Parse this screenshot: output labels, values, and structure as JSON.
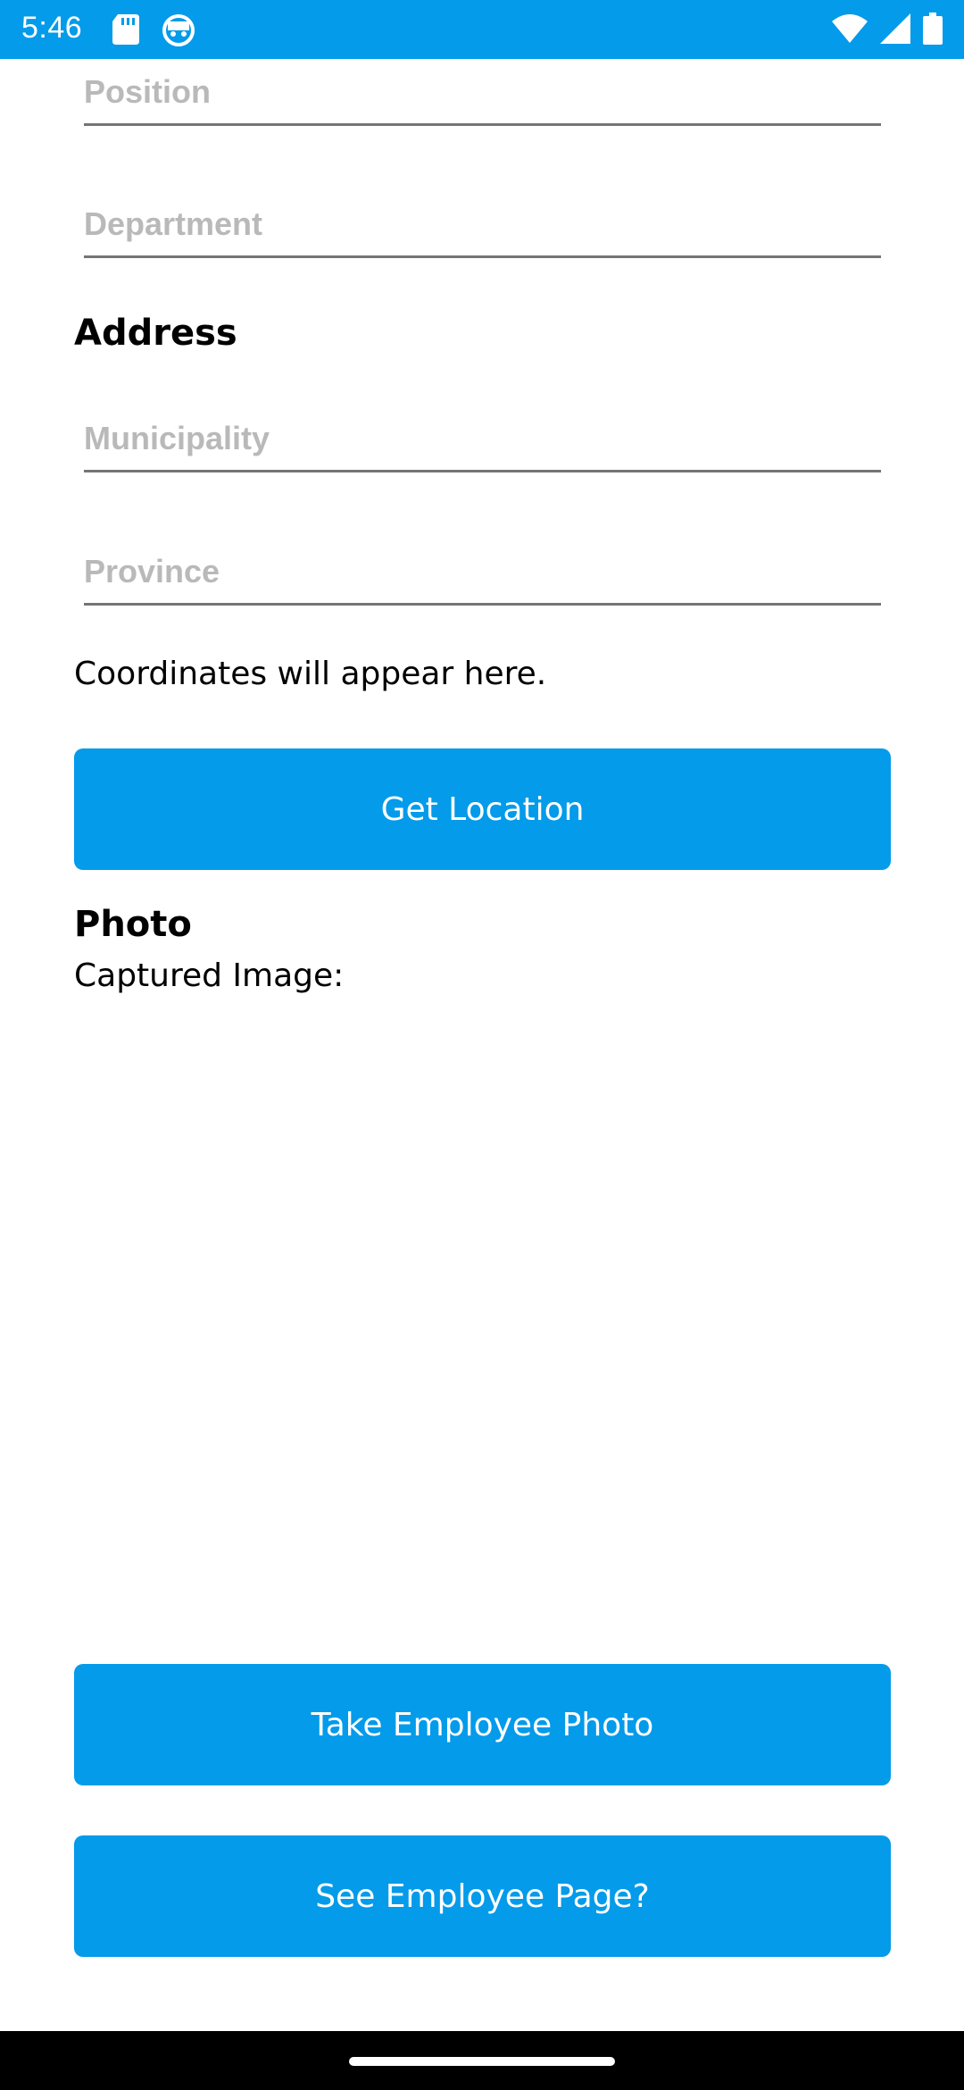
{
  "status_bar": {
    "time": "5:46",
    "left_icons": [
      "sd-card-icon",
      "android-face-icon"
    ],
    "right_icons": [
      "wifi-icon",
      "signal-icon",
      "battery-icon"
    ],
    "color": "#039BEA"
  },
  "form": {
    "position_placeholder": "Position",
    "department_placeholder": "Department",
    "address_heading": "Address",
    "municipality_placeholder": "Municipality",
    "province_placeholder": "Province",
    "coordinates_text": "Coordinates will appear here.",
    "get_location_label": "Get Location",
    "photo_heading": "Photo",
    "captured_image_label": "Captured Image:",
    "take_photo_label": "Take Employee Photo",
    "see_employee_label": "See Employee Page?"
  },
  "colors": {
    "accent": "#039BEA",
    "placeholder": "#B9B9B9",
    "underline": "#757575"
  }
}
